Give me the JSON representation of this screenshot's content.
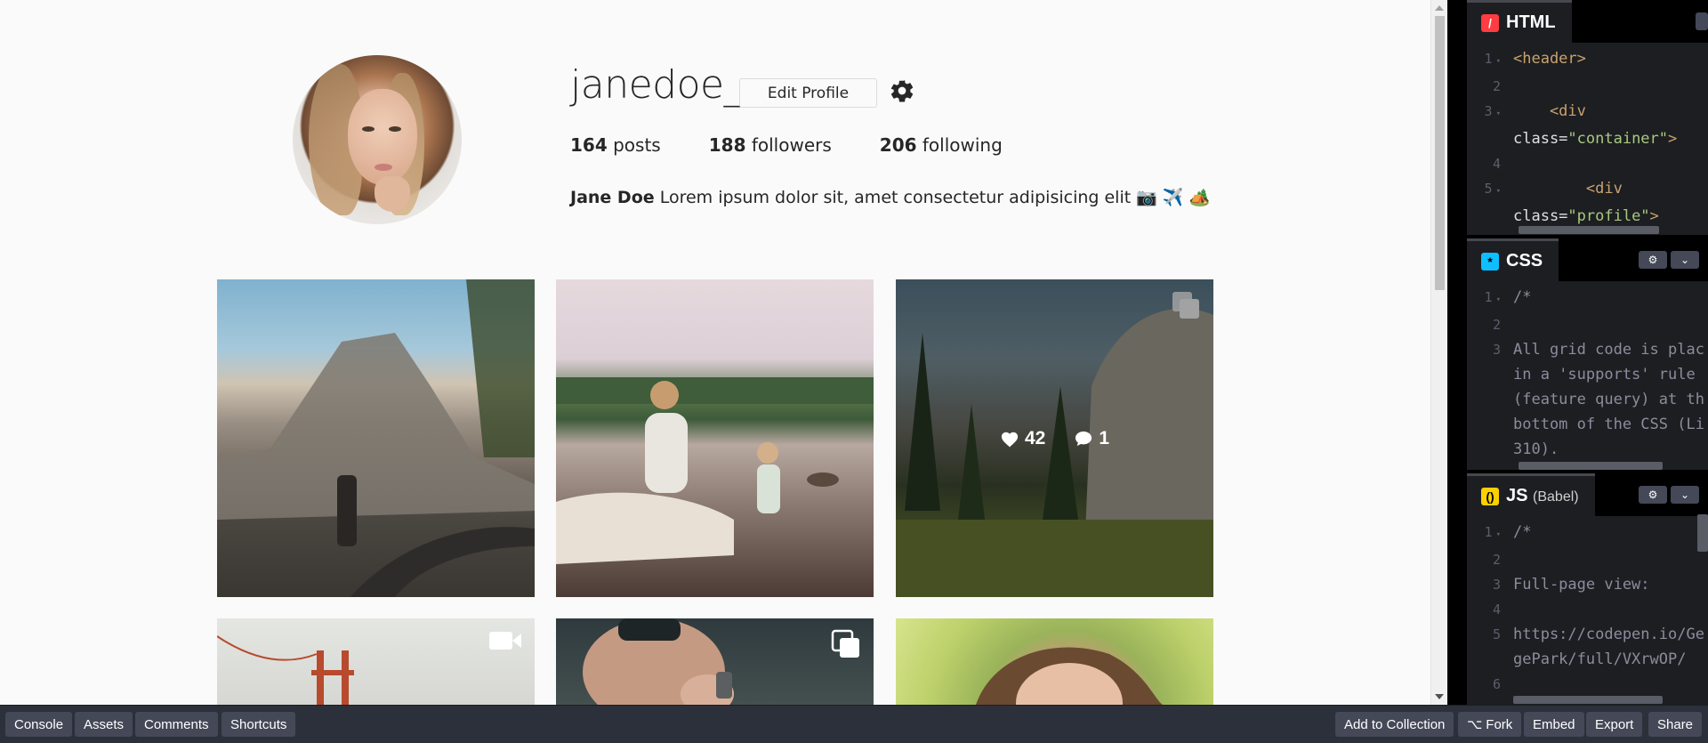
{
  "profile": {
    "username": "janedoe_",
    "edit_button": "Edit Profile",
    "stats": [
      {
        "count": "164",
        "label": "posts"
      },
      {
        "count": "188",
        "label": "followers"
      },
      {
        "count": "206",
        "label": "following"
      }
    ],
    "bio_name": "Jane Doe",
    "bio_text": "Lorem ipsum dolor sit, amet consectetur adipisicing elit 📷 ✈️ 🏕️"
  },
  "gallery": {
    "hover_likes": "42",
    "hover_comments": "1"
  },
  "editors": {
    "html": {
      "title": "HTML",
      "lines": [
        {
          "n": "1",
          "fold": true,
          "parts": [
            {
              "c": "tag",
              "t": "<header>"
            }
          ]
        },
        {
          "n": "2",
          "fold": false,
          "parts": []
        },
        {
          "n": "3",
          "fold": true,
          "parts": [
            {
              "c": "tag",
              "t": "    <div"
            }
          ]
        },
        {
          "n": "",
          "fold": false,
          "parts": [
            {
              "c": "attr",
              "t": "class="
            },
            {
              "c": "str",
              "t": "\"container\""
            },
            {
              "c": "tag",
              "t": ">"
            }
          ]
        },
        {
          "n": "4",
          "fold": false,
          "parts": []
        },
        {
          "n": "5",
          "fold": true,
          "parts": [
            {
              "c": "tag",
              "t": "        <div"
            }
          ]
        },
        {
          "n": "",
          "fold": false,
          "parts": [
            {
              "c": "attr",
              "t": "class="
            },
            {
              "c": "str",
              "t": "\"profile\""
            },
            {
              "c": "tag",
              "t": ">"
            }
          ]
        }
      ]
    },
    "css": {
      "title": "CSS",
      "lines": [
        {
          "n": "1",
          "fold": true,
          "parts": [
            {
              "c": "cmt",
              "t": "/*"
            }
          ]
        },
        {
          "n": "2",
          "fold": false,
          "parts": []
        },
        {
          "n": "3",
          "fold": false,
          "parts": [
            {
              "c": "cmt",
              "t": "All grid code is plac"
            }
          ]
        },
        {
          "n": "",
          "fold": false,
          "parts": [
            {
              "c": "cmt",
              "t": "in a 'supports' rule"
            }
          ]
        },
        {
          "n": "",
          "fold": false,
          "parts": [
            {
              "c": "cmt",
              "t": "(feature query) at th"
            }
          ]
        },
        {
          "n": "",
          "fold": false,
          "parts": [
            {
              "c": "cmt",
              "t": "bottom of the CSS (Li"
            }
          ]
        },
        {
          "n": "",
          "fold": false,
          "parts": [
            {
              "c": "cmt",
              "t": "310)."
            }
          ]
        }
      ]
    },
    "js": {
      "title": "JS",
      "subtitle": "(Babel)",
      "lines": [
        {
          "n": "1",
          "fold": true,
          "parts": [
            {
              "c": "cmt",
              "t": "/*"
            }
          ]
        },
        {
          "n": "2",
          "fold": false,
          "parts": []
        },
        {
          "n": "3",
          "fold": false,
          "parts": [
            {
              "c": "cmt",
              "t": "Full-page view:"
            }
          ]
        },
        {
          "n": "4",
          "fold": false,
          "parts": []
        },
        {
          "n": "5",
          "fold": false,
          "parts": [
            {
              "c": "cmt",
              "t": "https://codepen.io/Ge"
            }
          ]
        },
        {
          "n": "",
          "fold": false,
          "parts": [
            {
              "c": "cmt",
              "t": "gePark/full/VXrwOP/"
            }
          ]
        },
        {
          "n": "6",
          "fold": false,
          "parts": []
        }
      ]
    }
  },
  "bottombar": {
    "left": [
      "Console",
      "Assets",
      "Comments",
      "Shortcuts"
    ],
    "right": [
      "Add to Collection",
      "Fork",
      "Embed",
      "Export",
      "Share"
    ],
    "fork_icon": "⌥"
  },
  "colors": {
    "html_badge": "#ff3c41",
    "css_badge": "#0ebeff",
    "js_badge": "#fcd000"
  }
}
